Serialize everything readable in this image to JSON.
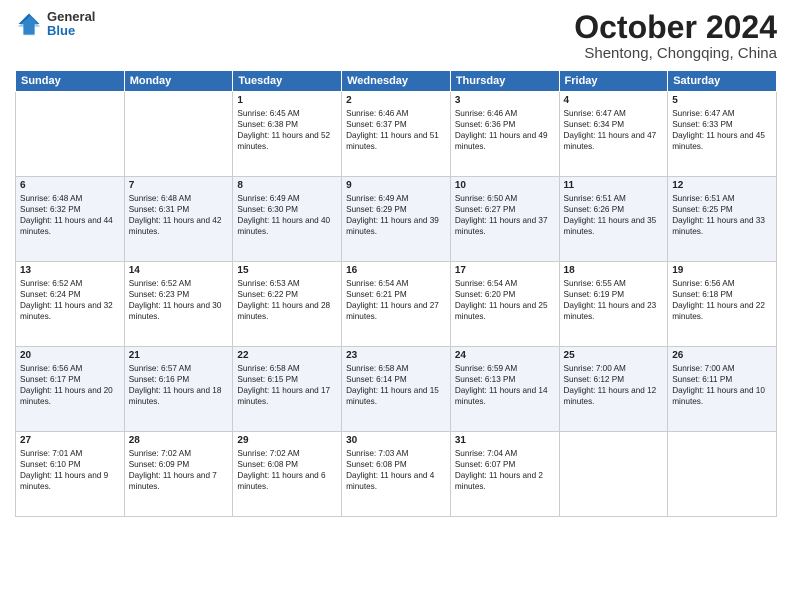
{
  "logo": {
    "general": "General",
    "blue": "Blue"
  },
  "title": "October 2024",
  "location": "Shentong, Chongqing, China",
  "days_header": [
    "Sunday",
    "Monday",
    "Tuesday",
    "Wednesday",
    "Thursday",
    "Friday",
    "Saturday"
  ],
  "weeks": [
    [
      {
        "day": "",
        "content": ""
      },
      {
        "day": "",
        "content": ""
      },
      {
        "day": "1",
        "content": "Sunrise: 6:45 AM\nSunset: 6:38 PM\nDaylight: 11 hours and 52 minutes."
      },
      {
        "day": "2",
        "content": "Sunrise: 6:46 AM\nSunset: 6:37 PM\nDaylight: 11 hours and 51 minutes."
      },
      {
        "day": "3",
        "content": "Sunrise: 6:46 AM\nSunset: 6:36 PM\nDaylight: 11 hours and 49 minutes."
      },
      {
        "day": "4",
        "content": "Sunrise: 6:47 AM\nSunset: 6:34 PM\nDaylight: 11 hours and 47 minutes."
      },
      {
        "day": "5",
        "content": "Sunrise: 6:47 AM\nSunset: 6:33 PM\nDaylight: 11 hours and 45 minutes."
      }
    ],
    [
      {
        "day": "6",
        "content": "Sunrise: 6:48 AM\nSunset: 6:32 PM\nDaylight: 11 hours and 44 minutes."
      },
      {
        "day": "7",
        "content": "Sunrise: 6:48 AM\nSunset: 6:31 PM\nDaylight: 11 hours and 42 minutes."
      },
      {
        "day": "8",
        "content": "Sunrise: 6:49 AM\nSunset: 6:30 PM\nDaylight: 11 hours and 40 minutes."
      },
      {
        "day": "9",
        "content": "Sunrise: 6:49 AM\nSunset: 6:29 PM\nDaylight: 11 hours and 39 minutes."
      },
      {
        "day": "10",
        "content": "Sunrise: 6:50 AM\nSunset: 6:27 PM\nDaylight: 11 hours and 37 minutes."
      },
      {
        "day": "11",
        "content": "Sunrise: 6:51 AM\nSunset: 6:26 PM\nDaylight: 11 hours and 35 minutes."
      },
      {
        "day": "12",
        "content": "Sunrise: 6:51 AM\nSunset: 6:25 PM\nDaylight: 11 hours and 33 minutes."
      }
    ],
    [
      {
        "day": "13",
        "content": "Sunrise: 6:52 AM\nSunset: 6:24 PM\nDaylight: 11 hours and 32 minutes."
      },
      {
        "day": "14",
        "content": "Sunrise: 6:52 AM\nSunset: 6:23 PM\nDaylight: 11 hours and 30 minutes."
      },
      {
        "day": "15",
        "content": "Sunrise: 6:53 AM\nSunset: 6:22 PM\nDaylight: 11 hours and 28 minutes."
      },
      {
        "day": "16",
        "content": "Sunrise: 6:54 AM\nSunset: 6:21 PM\nDaylight: 11 hours and 27 minutes."
      },
      {
        "day": "17",
        "content": "Sunrise: 6:54 AM\nSunset: 6:20 PM\nDaylight: 11 hours and 25 minutes."
      },
      {
        "day": "18",
        "content": "Sunrise: 6:55 AM\nSunset: 6:19 PM\nDaylight: 11 hours and 23 minutes."
      },
      {
        "day": "19",
        "content": "Sunrise: 6:56 AM\nSunset: 6:18 PM\nDaylight: 11 hours and 22 minutes."
      }
    ],
    [
      {
        "day": "20",
        "content": "Sunrise: 6:56 AM\nSunset: 6:17 PM\nDaylight: 11 hours and 20 minutes."
      },
      {
        "day": "21",
        "content": "Sunrise: 6:57 AM\nSunset: 6:16 PM\nDaylight: 11 hours and 18 minutes."
      },
      {
        "day": "22",
        "content": "Sunrise: 6:58 AM\nSunset: 6:15 PM\nDaylight: 11 hours and 17 minutes."
      },
      {
        "day": "23",
        "content": "Sunrise: 6:58 AM\nSunset: 6:14 PM\nDaylight: 11 hours and 15 minutes."
      },
      {
        "day": "24",
        "content": "Sunrise: 6:59 AM\nSunset: 6:13 PM\nDaylight: 11 hours and 14 minutes."
      },
      {
        "day": "25",
        "content": "Sunrise: 7:00 AM\nSunset: 6:12 PM\nDaylight: 11 hours and 12 minutes."
      },
      {
        "day": "26",
        "content": "Sunrise: 7:00 AM\nSunset: 6:11 PM\nDaylight: 11 hours and 10 minutes."
      }
    ],
    [
      {
        "day": "27",
        "content": "Sunrise: 7:01 AM\nSunset: 6:10 PM\nDaylight: 11 hours and 9 minutes."
      },
      {
        "day": "28",
        "content": "Sunrise: 7:02 AM\nSunset: 6:09 PM\nDaylight: 11 hours and 7 minutes."
      },
      {
        "day": "29",
        "content": "Sunrise: 7:02 AM\nSunset: 6:08 PM\nDaylight: 11 hours and 6 minutes."
      },
      {
        "day": "30",
        "content": "Sunrise: 7:03 AM\nSunset: 6:08 PM\nDaylight: 11 hours and 4 minutes."
      },
      {
        "day": "31",
        "content": "Sunrise: 7:04 AM\nSunset: 6:07 PM\nDaylight: 11 hours and 2 minutes."
      },
      {
        "day": "",
        "content": ""
      },
      {
        "day": "",
        "content": ""
      }
    ]
  ]
}
